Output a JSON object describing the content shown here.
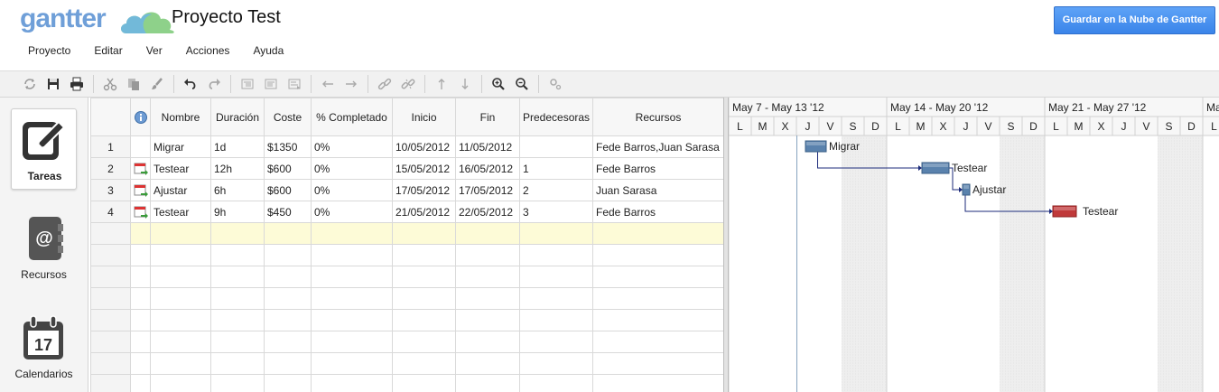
{
  "app": {
    "logo_text": "gantter",
    "project_title": "Proyecto Test",
    "save_button": "Guardar en la Nube de Gantter"
  },
  "menu": [
    {
      "label": "Proyecto"
    },
    {
      "label": "Editar"
    },
    {
      "label": "Ver"
    },
    {
      "label": "Acciones"
    },
    {
      "label": "Ayuda"
    }
  ],
  "sidebar": {
    "tasks_label": "Tareas",
    "resources_label": "Recursos",
    "calendars_label": "Calendarios",
    "calendar_day": "17"
  },
  "grid": {
    "columns": {
      "info": "i",
      "name": "Nombre",
      "duration": "Duración",
      "cost": "Coste",
      "complete": "% Completado",
      "start": "Inicio",
      "end": "Fin",
      "predecessors": "Predecesoras",
      "resources": "Recursos"
    },
    "rows": [
      {
        "num": "1",
        "name": "Migrar",
        "duration": "1d",
        "cost": "$1350",
        "complete": "0%",
        "start": "10/05/2012",
        "end": "11/05/2012",
        "pred": "",
        "resources": "Fede Barros,Juan Sarasa",
        "icon": ""
      },
      {
        "num": "2",
        "name": "Testear",
        "duration": "12h",
        "cost": "$600",
        "complete": "0%",
        "start": "15/05/2012",
        "end": "16/05/2012",
        "pred": "1",
        "resources": "Fede Barros",
        "icon": "calendar-task-icon"
      },
      {
        "num": "3",
        "name": "Ajustar",
        "duration": "6h",
        "cost": "$600",
        "complete": "0%",
        "start": "17/05/2012",
        "end": "17/05/2012",
        "pred": "2",
        "resources": "Juan Sarasa",
        "icon": "calendar-task-icon"
      },
      {
        "num": "4",
        "name": "Testear",
        "duration": "9h",
        "cost": "$450",
        "complete": "0%",
        "start": "21/05/2012",
        "end": "22/05/2012",
        "pred": "3",
        "resources": "Fede Barros",
        "icon": "calendar-task-icon"
      }
    ]
  },
  "gantt": {
    "weeks": [
      "May 7 - May 13 '12",
      "May 14 - May 20 '12",
      "May 21 - May 27 '12",
      "Ma"
    ],
    "days": [
      "L",
      "M",
      "X",
      "J",
      "V",
      "S",
      "D"
    ],
    "bar_labels": [
      "Migrar",
      "Testear",
      "Ajustar",
      "Testear"
    ],
    "colors": {
      "bar": "#5a82ad",
      "bar_critical": "#c0393a",
      "link": "#1b2a7a",
      "today": "#86a3bf"
    }
  },
  "toolbar_icons": [
    "refresh-icon",
    "save-icon",
    "print-icon",
    "cut-icon",
    "copy-icon",
    "paint-icon",
    "undo-icon",
    "redo-icon",
    "indent-icon",
    "outdent-icon",
    "summary-icon",
    "arrow-left-icon",
    "arrow-right-icon",
    "link-icon",
    "unlink-icon",
    "arrow-up-icon",
    "arrow-down-icon",
    "zoom-in-icon",
    "zoom-out-icon",
    "settings-icon"
  ]
}
